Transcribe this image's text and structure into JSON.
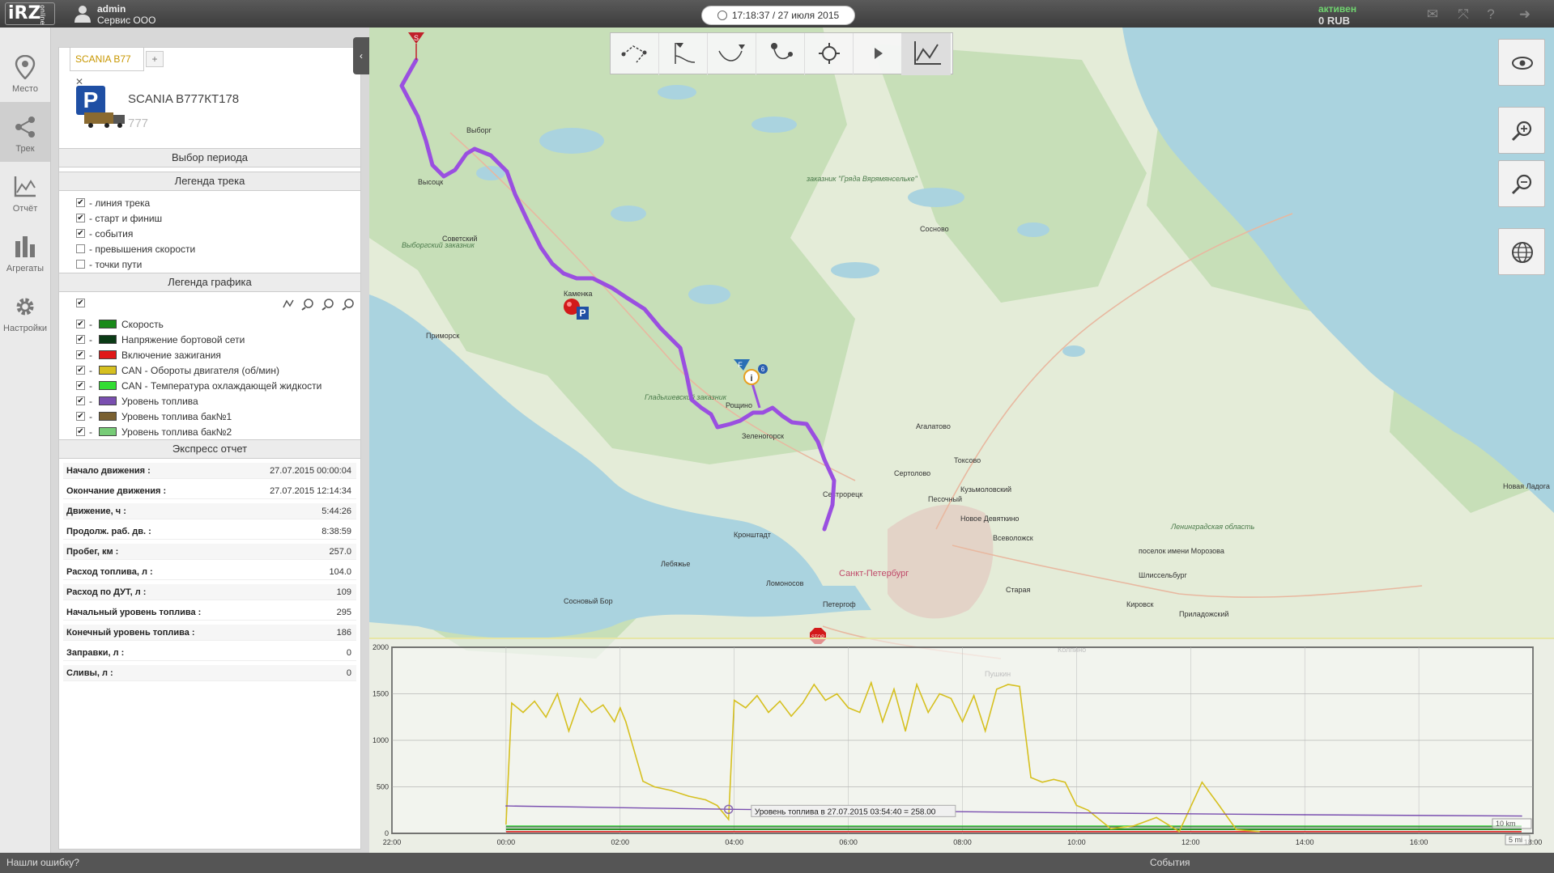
{
  "topbar": {
    "logo": "iRZ",
    "logo_sub": "online",
    "user_name": "admin",
    "user_org": "Сервис ООО",
    "clock": "17:18:37 / 27 июля 2015",
    "account_status": "активен",
    "account_balance": "0 RUB",
    "icons": [
      "mail-icon",
      "fullscreen-icon",
      "help-icon",
      "logout-icon"
    ]
  },
  "nav": [
    {
      "label": "Место",
      "icon": "location-pin-icon"
    },
    {
      "label": "Трек",
      "icon": "share-track-icon",
      "active": true
    },
    {
      "label": "Отчёт",
      "icon": "report-chart-icon"
    },
    {
      "label": "Агрегаты",
      "icon": "bars-icon"
    },
    {
      "label": "Настройки",
      "icon": "gear-icon"
    }
  ],
  "panel": {
    "tab_label": "SCANIA В77",
    "tab_add": "+",
    "vehicle_name": "SCANIA В777КТ178",
    "vehicle_sub": "777",
    "parking_badge": "P",
    "period_header": "Выбор периода",
    "track_legend_header": "Легенда трека",
    "track_legend": [
      {
        "label": "- линия трека",
        "checked": true
      },
      {
        "label": "- старт и финиш",
        "checked": true
      },
      {
        "label": "- события",
        "checked": true
      },
      {
        "label": "- превышения скорости",
        "checked": false
      },
      {
        "label": "- точки пути",
        "checked": false
      }
    ],
    "graph_legend_header": "Легенда графика",
    "graph_legend": [
      {
        "label": "Скорость",
        "color": "#1a8a1a"
      },
      {
        "label": "Напряжение бортовой сети",
        "color": "#0b3b16"
      },
      {
        "label": "Включение зажигания",
        "color": "#e01818"
      },
      {
        "label": "CAN - Обороты двигателя (об/мин)",
        "color": "#d6c020"
      },
      {
        "label": "CAN - Температура охлаждающей жидкости",
        "color": "#33dd33"
      },
      {
        "label": "Уровень топлива",
        "color": "#7a4fb0"
      },
      {
        "label": "Уровень топлива бак№1",
        "color": "#7a6030"
      },
      {
        "label": "Уровень топлива бак№2",
        "color": "#77cc77"
      }
    ],
    "graph_legend_dash": "-",
    "express_header": "Экспресс отчет",
    "express": [
      {
        "k": "Начало движения :",
        "v": "27.07.2015 00:00:04"
      },
      {
        "k": "Окончание движения :",
        "v": "27.07.2015 12:14:34"
      },
      {
        "k": "Движение, ч :",
        "v": "5:44:26"
      },
      {
        "k": "Продолж. раб. дв. :",
        "v": "8:38:59"
      },
      {
        "k": "Пробег, км :",
        "v": "257.0"
      },
      {
        "k": "Расход топлива, л :",
        "v": "104.0"
      },
      {
        "k": "Расход по ДУТ, л :",
        "v": "109"
      },
      {
        "k": "Начальный уровень топлива :",
        "v": "295"
      },
      {
        "k": "Конечный уровень топлива :",
        "v": "186"
      },
      {
        "k": "Заправки, л :",
        "v": "0"
      },
      {
        "k": "Сливы, л :",
        "v": "0"
      }
    ]
  },
  "map": {
    "labels": [
      {
        "t": "Выборг"
      },
      {
        "t": "Высоцк"
      },
      {
        "t": "Советский"
      },
      {
        "t": "Выборгский заказник"
      },
      {
        "t": "Каменка"
      },
      {
        "t": "Приморск"
      },
      {
        "t": "Гладышевский заказник"
      },
      {
        "t": "Рощино"
      },
      {
        "t": "Зеленогорск"
      },
      {
        "t": "Сестрорецк"
      },
      {
        "t": "Кронштадт"
      },
      {
        "t": "Лебяжье"
      },
      {
        "t": "Ломоносов"
      },
      {
        "t": "Сосновый Бор"
      },
      {
        "t": "Петергоф"
      },
      {
        "t": "Санкт-Петербург"
      },
      {
        "t": "Сертолово"
      },
      {
        "t": "Агалатово"
      },
      {
        "t": "Токсово"
      },
      {
        "t": "Кузьмоловский"
      },
      {
        "t": "Новое Девяткино"
      },
      {
        "t": "Всеволожск"
      },
      {
        "t": "Песочный"
      },
      {
        "t": "Старая"
      },
      {
        "t": "Сосново"
      },
      {
        "t": "заказник \"Гряда Вярямянсельке\""
      },
      {
        "t": "Ленинградская область"
      },
      {
        "t": "поселок имени Морозова"
      },
      {
        "t": "Шлиссельбург"
      },
      {
        "t": "Кировск"
      },
      {
        "t": "Приладожский"
      },
      {
        "t": "Новая Ладога"
      },
      {
        "t": "Колпино"
      },
      {
        "t": "Пушкин"
      }
    ],
    "markers": {
      "start": "S",
      "finish": "F",
      "stop": "STOP",
      "parking": "P",
      "info": "i",
      "event": "6"
    },
    "toolbar": [
      "select-area-icon",
      "track-start-icon",
      "track-route-icon",
      "waypoint-icon",
      "locate-icon",
      "play-icon",
      "graph-icon"
    ],
    "right_tools": [
      "view-eye-icon",
      "zoom-in-icon",
      "zoom-out-icon",
      "globe-icon"
    ]
  },
  "chart_data": {
    "type": "line",
    "x_ticks": [
      "22:00",
      "00:00",
      "02:00",
      "04:00",
      "06:00",
      "08:00",
      "10:00",
      "12:00",
      "14:00",
      "16:00",
      "18:00"
    ],
    "y_ticks": [
      "0",
      "500",
      "1000",
      "1500",
      "2000"
    ],
    "ylim": [
      0,
      2000
    ],
    "x_range_hours": [
      -2,
      18
    ],
    "series": [
      {
        "name": "CAN - Обороты двигателя (об/мин)",
        "color": "#d6c020",
        "x": [
          0.0,
          0.1,
          0.3,
          0.5,
          0.7,
          0.9,
          1.1,
          1.3,
          1.5,
          1.7,
          1.9,
          2.0,
          2.1,
          2.4,
          2.6,
          2.9,
          3.2,
          3.5,
          3.7,
          3.9,
          4.0,
          4.2,
          4.4,
          4.6,
          4.8,
          5.0,
          5.2,
          5.4,
          5.6,
          5.8,
          6.0,
          6.2,
          6.4,
          6.6,
          6.8,
          7.0,
          7.2,
          7.4,
          7.6,
          7.8,
          8.0,
          8.2,
          8.4,
          8.6,
          8.8,
          9.0,
          9.2,
          9.4,
          9.6,
          9.8,
          10.0,
          10.2,
          10.6,
          11.0,
          11.4,
          11.8,
          12.2,
          12.5,
          12.8,
          13.2
        ],
        "y": [
          100,
          1400,
          1300,
          1420,
          1250,
          1500,
          1100,
          1450,
          1300,
          1380,
          1200,
          1350,
          1200,
          560,
          500,
          460,
          400,
          360,
          300,
          150,
          1430,
          1350,
          1480,
          1300,
          1420,
          1260,
          1400,
          1600,
          1430,
          1500,
          1350,
          1300,
          1620,
          1200,
          1550,
          1100,
          1600,
          1300,
          1500,
          1450,
          1200,
          1480,
          1100,
          1550,
          1600,
          1580,
          600,
          550,
          580,
          550,
          300,
          250,
          50,
          80,
          170,
          20,
          550,
          300,
          40,
          20
        ]
      },
      {
        "name": "Уровень топлива",
        "color": "#7a4fb0",
        "x": [
          0,
          4,
          6,
          10,
          14,
          17.8
        ],
        "y": [
          295,
          258,
          245,
          220,
          200,
          186
        ]
      }
    ],
    "tooltip": "Уровень топлива в 27.07.2015 03:54:40 = 258.00",
    "scale_km": "10 km",
    "scale_mi": "5 mi"
  },
  "bottombar": {
    "report_error": "Нашли ошибку?",
    "events": "События"
  }
}
